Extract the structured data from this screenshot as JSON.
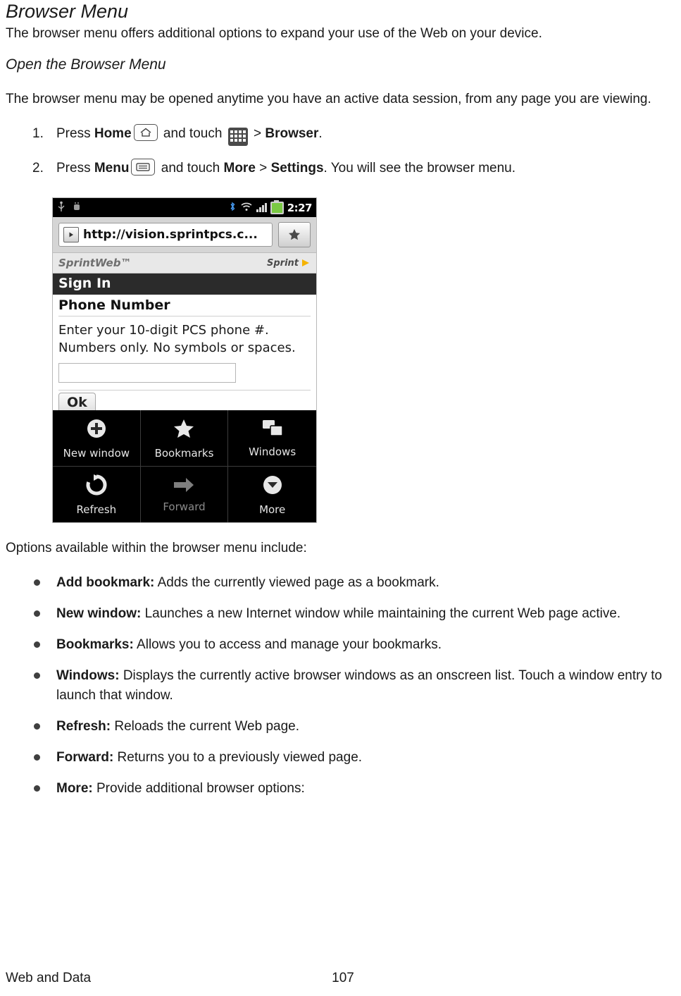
{
  "doc": {
    "title": "Browser Menu",
    "intro": "The browser menu offers additional options to expand your use of the Web on your device.",
    "section_heading": "Open the Browser Menu",
    "section_intro": "The browser menu may be opened anytime you have an active data session, from any page you are viewing.",
    "steps": [
      {
        "num": "1.",
        "pre": "Press ",
        "bold1": "Home",
        "mid1": " and touch ",
        "mid2": " > ",
        "bold2": "Browser",
        "post": "."
      },
      {
        "num": "2.",
        "pre": "Press ",
        "bold1": "Menu",
        "mid1": " and touch ",
        "bold2": "More",
        "mid2": " > ",
        "bold3": "Settings",
        "post": ". You will see the browser menu."
      }
    ],
    "options_intro": "Options available within the browser menu include:",
    "bullets": [
      {
        "term": "Add bookmark:",
        "desc": " Adds the currently viewed page as a bookmark."
      },
      {
        "term": "New window:",
        "desc": " Launches a new Internet window while maintaining the current Web page active."
      },
      {
        "term": "Bookmarks:",
        "desc": " Allows you to access and manage your bookmarks."
      },
      {
        "term": "Windows:",
        "desc": " Displays the currently active browser windows as an onscreen list. Touch a window entry to launch that window."
      },
      {
        "term": "Refresh:",
        "desc": " Reloads the current Web page."
      },
      {
        "term": "Forward:",
        "desc": " Returns you to a previously viewed page."
      },
      {
        "term": "More:",
        "desc": " Provide additional browser options:"
      }
    ]
  },
  "screenshot": {
    "status": {
      "time": "2:27"
    },
    "url": "http://vision.sprintpcs.c...",
    "brand_left": "SprintWeb™",
    "brand_right": "Sprint",
    "signin": "Sign In",
    "field_label": "Phone Number",
    "instruction_line1": "Enter your 10-digit PCS phone #.",
    "instruction_line2": "Numbers only. No symbols or spaces.",
    "input_value": "",
    "ok_label": "Ok",
    "menu": [
      {
        "label": "New window",
        "icon": "plus-circle-icon"
      },
      {
        "label": "Bookmarks",
        "icon": "star-icon"
      },
      {
        "label": "Windows",
        "icon": "windows-icon"
      },
      {
        "label": "Refresh",
        "icon": "refresh-icon"
      },
      {
        "label": "Forward",
        "icon": "forward-arrow-icon"
      },
      {
        "label": "More",
        "icon": "more-chevron-icon"
      }
    ]
  },
  "footer": {
    "section": "Web and Data",
    "page": "107"
  }
}
